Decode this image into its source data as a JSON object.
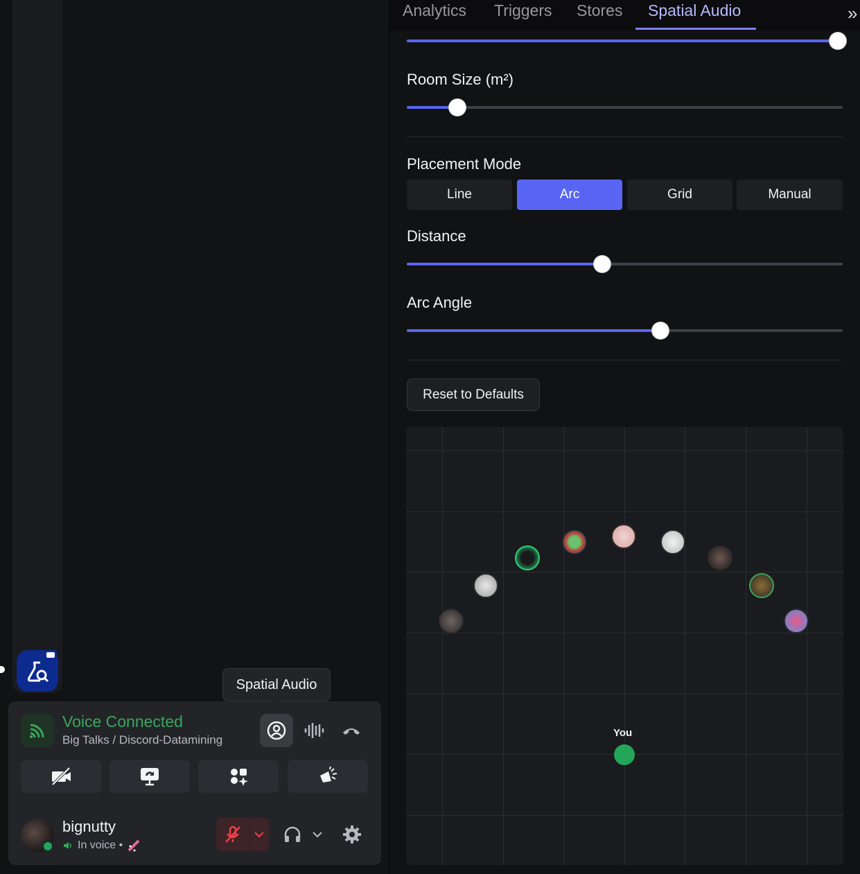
{
  "tabs": [
    "Analytics",
    "Triggers",
    "Stores",
    "Spatial Audio"
  ],
  "active_tab": "Spatial Audio",
  "settings": {
    "top_slider_value": 1.0,
    "room_size": {
      "label": "Room Size (m²)",
      "value": 0.12
    },
    "placement": {
      "label": "Placement Mode",
      "options": [
        "Line",
        "Arc",
        "Grid",
        "Manual"
      ],
      "selected": "Arc"
    },
    "distance": {
      "label": "Distance",
      "value": 0.45
    },
    "arc_angle": {
      "label": "Arc Angle",
      "value": 0.58
    },
    "reset_label": "Reset to Defaults"
  },
  "map": {
    "you_label": "You",
    "you_color": "#23a55a",
    "peer_count": 9
  },
  "tooltip": "Spatial Audio",
  "voice": {
    "status": "Voice Connected",
    "channel": "Big Talks / Discord-Datamining",
    "status_color": "#3ba55d"
  },
  "user": {
    "name": "bignutty",
    "status_text": "In voice •"
  },
  "colors": {
    "accent": "#5865f2",
    "danger": "#f23f43"
  }
}
